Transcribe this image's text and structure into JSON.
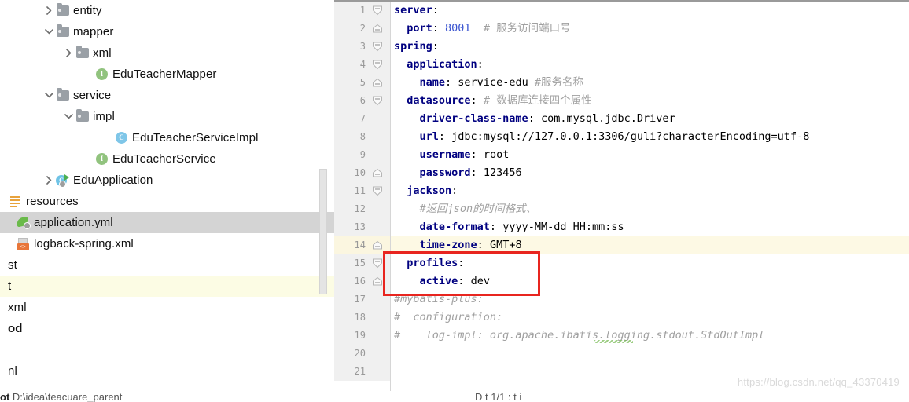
{
  "project_tree": {
    "items": [
      {
        "label": "entity",
        "icon": "folder-icon",
        "twisty": "chevron-right-icon",
        "indent": 55,
        "state": "normal"
      },
      {
        "label": "mapper",
        "icon": "folder-icon",
        "twisty": "chevron-down-icon",
        "indent": 55,
        "state": "normal"
      },
      {
        "label": "xml",
        "icon": "folder-icon",
        "twisty": "chevron-right-icon",
        "indent": 80,
        "state": "normal"
      },
      {
        "label": "EduTeacherMapper",
        "icon": "interface-icon",
        "twisty": "none",
        "indent": 105,
        "state": "normal",
        "badge": "I"
      },
      {
        "label": "service",
        "icon": "folder-icon",
        "twisty": "chevron-down-icon",
        "indent": 55,
        "state": "normal"
      },
      {
        "label": "impl",
        "icon": "folder-icon",
        "twisty": "chevron-down-icon",
        "indent": 80,
        "state": "normal"
      },
      {
        "label": "EduTeacherServiceImpl",
        "icon": "class-icon",
        "twisty": "none",
        "indent": 130,
        "state": "normal",
        "badge": "C"
      },
      {
        "label": "EduTeacherService",
        "icon": "interface-icon",
        "twisty": "none",
        "indent": 105,
        "state": "normal",
        "badge": "I"
      },
      {
        "label": "EduApplication",
        "icon": "spring-run-icon",
        "twisty": "chevron-right-icon",
        "indent": 55,
        "state": "normal"
      },
      {
        "label": "resources",
        "icon": "resources-icon",
        "twisty": "none",
        "indent": -5,
        "state": "normal"
      },
      {
        "label": "application.yml",
        "icon": "spring-leaf-icon",
        "twisty": "none",
        "indent": 5,
        "state": "selected"
      },
      {
        "label": "logback-spring.xml",
        "icon": "xml-file-icon",
        "twisty": "none",
        "indent": 5,
        "state": "normal"
      },
      {
        "label": "st",
        "icon": "none",
        "twisty": "none",
        "indent": -5,
        "state": "normal"
      },
      {
        "label": "t",
        "icon": "none",
        "twisty": "none",
        "indent": -5,
        "state": "highlight"
      },
      {
        "label": "xml",
        "icon": "none",
        "twisty": "none",
        "indent": -5,
        "state": "normal"
      },
      {
        "label": "od",
        "icon": "none",
        "twisty": "none",
        "indent": -5,
        "state": "normal",
        "bold": true
      },
      {
        "label": "",
        "icon": "none",
        "twisty": "none",
        "indent": -5,
        "state": "normal"
      },
      {
        "label": "nl",
        "icon": "none",
        "twisty": "none",
        "indent": -5,
        "state": "normal"
      }
    ]
  },
  "editor": {
    "filename": "application.yml",
    "lines": [
      {
        "no": "1",
        "indent": 0,
        "segments": [
          {
            "t": "server",
            "c": "k"
          },
          {
            "t": ":",
            "c": "kv"
          }
        ],
        "fold": "expanded",
        "hl": false
      },
      {
        "no": "2",
        "indent": 1,
        "segments": [
          {
            "t": "port",
            "c": "k"
          },
          {
            "t": ": ",
            "c": "kv"
          },
          {
            "t": "8001",
            "c": "num"
          },
          {
            "t": "  # 服务访问端口号",
            "c": "cm-plain"
          }
        ],
        "fold": "end",
        "hl": false
      },
      {
        "no": "3",
        "indent": 0,
        "segments": [
          {
            "t": "spring",
            "c": "k"
          },
          {
            "t": ":",
            "c": "kv"
          }
        ],
        "fold": "expanded",
        "hl": false
      },
      {
        "no": "4",
        "indent": 1,
        "segments": [
          {
            "t": "application",
            "c": "k"
          },
          {
            "t": ":",
            "c": "kv"
          }
        ],
        "fold": "expanded",
        "hl": false
      },
      {
        "no": "5",
        "indent": 2,
        "segments": [
          {
            "t": "name",
            "c": "k"
          },
          {
            "t": ": ",
            "c": "kv"
          },
          {
            "t": "service-edu",
            "c": "val"
          },
          {
            "t": " #服务名称",
            "c": "cm-plain"
          }
        ],
        "fold": "end",
        "hl": false
      },
      {
        "no": "6",
        "indent": 1,
        "segments": [
          {
            "t": "datasource",
            "c": "k"
          },
          {
            "t": ": ",
            "c": "kv"
          },
          {
            "t": "# 数据库连接四个属性",
            "c": "cm-plain"
          }
        ],
        "fold": "expanded",
        "hl": false
      },
      {
        "no": "7",
        "indent": 2,
        "segments": [
          {
            "t": "driver-class-name",
            "c": "k"
          },
          {
            "t": ": ",
            "c": "kv"
          },
          {
            "t": "com.mysql.jdbc.Driver",
            "c": "val"
          }
        ],
        "fold": "none",
        "hl": false
      },
      {
        "no": "8",
        "indent": 2,
        "segments": [
          {
            "t": "url",
            "c": "k"
          },
          {
            "t": ": ",
            "c": "kv"
          },
          {
            "t": "jdbc:mysql://127.0.0.1:3306/guli?characterEncoding=utf-8",
            "c": "val"
          }
        ],
        "fold": "none",
        "hl": false
      },
      {
        "no": "9",
        "indent": 2,
        "segments": [
          {
            "t": "username",
            "c": "k"
          },
          {
            "t": ": ",
            "c": "kv"
          },
          {
            "t": "root",
            "c": "val"
          }
        ],
        "fold": "none",
        "hl": false
      },
      {
        "no": "10",
        "indent": 2,
        "segments": [
          {
            "t": "password",
            "c": "k"
          },
          {
            "t": ": ",
            "c": "kv"
          },
          {
            "t": "123456",
            "c": "val"
          }
        ],
        "fold": "end",
        "hl": false
      },
      {
        "no": "11",
        "indent": 1,
        "segments": [
          {
            "t": "jackson",
            "c": "k"
          },
          {
            "t": ":",
            "c": "kv"
          }
        ],
        "fold": "expanded",
        "hl": false
      },
      {
        "no": "12",
        "indent": 2,
        "segments": [
          {
            "t": "#返回json的时间格式、",
            "c": "cm"
          }
        ],
        "fold": "none",
        "hl": false
      },
      {
        "no": "13",
        "indent": 2,
        "segments": [
          {
            "t": "date-format",
            "c": "k"
          },
          {
            "t": ": ",
            "c": "kv"
          },
          {
            "t": "yyyy-MM-dd HH:mm:ss",
            "c": "val"
          }
        ],
        "fold": "none",
        "hl": false
      },
      {
        "no": "14",
        "indent": 2,
        "segments": [
          {
            "t": "time-zone",
            "c": "k"
          },
          {
            "t": ": ",
            "c": "kv"
          },
          {
            "t": "GMT+8",
            "c": "val"
          }
        ],
        "fold": "end",
        "hl": true
      },
      {
        "no": "15",
        "indent": 1,
        "segments": [
          {
            "t": "profiles",
            "c": "k"
          },
          {
            "t": ":",
            "c": "kv"
          }
        ],
        "fold": "expanded",
        "hl": false
      },
      {
        "no": "16",
        "indent": 2,
        "segments": [
          {
            "t": "active",
            "c": "k"
          },
          {
            "t": ": ",
            "c": "kv"
          },
          {
            "t": "dev",
            "c": "val"
          }
        ],
        "fold": "end",
        "hl": false
      },
      {
        "no": "17",
        "indent": 0,
        "segments": [
          {
            "t": "#mybatis-plus:",
            "c": "cm"
          }
        ],
        "fold": "none",
        "hl": false
      },
      {
        "no": "18",
        "indent": 0,
        "segments": [
          {
            "t": "#  configuration:",
            "c": "cm"
          }
        ],
        "fold": "none",
        "hl": false
      },
      {
        "no": "19",
        "indent": 0,
        "segments": [
          {
            "t": "#    log-impl: org.apache.ibatis.logging.stdout.StdOutImpl",
            "c": "cm"
          }
        ],
        "fold": "none",
        "hl": false
      },
      {
        "no": "20",
        "indent": 0,
        "segments": [],
        "fold": "none",
        "hl": false
      },
      {
        "no": "21",
        "indent": 0,
        "segments": [],
        "fold": "none",
        "hl": false
      }
    ],
    "annotation": {
      "name": "red-highlight-box",
      "color": "#e8251f",
      "covers": "profiles / active: dev"
    }
  },
  "watermark": {
    "text": "https://blog.csdn.net/qq_43370419"
  },
  "status_bar": {
    "left_bold": "ot",
    "left_path": "D:\\idea\\teacuare_parent",
    "right": "D                t 1/1  : t          i"
  },
  "colors": {
    "key": "#000080",
    "number": "#3a54d0",
    "comment": "#a0a0a0",
    "selection": "#d4d4d4",
    "line_highlight": "#fdf9e4",
    "gutter": "#f0f0f0",
    "accent_red": "#e8251f"
  }
}
